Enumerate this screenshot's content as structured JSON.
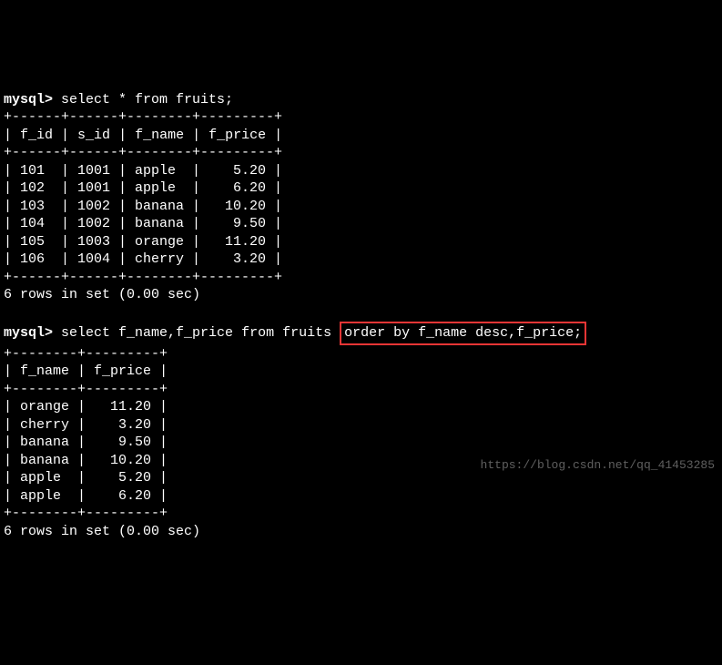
{
  "query1": {
    "prompt": "mysql>",
    "sql": "select * from fruits;",
    "headers": [
      "f_id",
      "s_id",
      "f_name",
      "f_price"
    ],
    "rows": [
      {
        "f_id": "101",
        "s_id": "1001",
        "f_name": "apple",
        "f_price": "5.20"
      },
      {
        "f_id": "102",
        "s_id": "1001",
        "f_name": "apple",
        "f_price": "6.20"
      },
      {
        "f_id": "103",
        "s_id": "1002",
        "f_name": "banana",
        "f_price": "10.20"
      },
      {
        "f_id": "104",
        "s_id": "1002",
        "f_name": "banana",
        "f_price": "9.50"
      },
      {
        "f_id": "105",
        "s_id": "1003",
        "f_name": "orange",
        "f_price": "11.20"
      },
      {
        "f_id": "106",
        "s_id": "1004",
        "f_name": "cherry",
        "f_price": "3.20"
      }
    ],
    "footer": "6 rows in set (0.00 sec)",
    "border": "+------+------+--------+---------+"
  },
  "query2": {
    "prompt": "mysql>",
    "sql_part1": "select f_name,f_price from fruits ",
    "sql_highlight": "order by f_name desc,f_price;",
    "headers": [
      "f_name",
      "f_price"
    ],
    "rows": [
      {
        "f_name": "orange",
        "f_price": "11.20"
      },
      {
        "f_name": "cherry",
        "f_price": "3.20"
      },
      {
        "f_name": "banana",
        "f_price": "9.50"
      },
      {
        "f_name": "banana",
        "f_price": "10.20"
      },
      {
        "f_name": "apple",
        "f_price": "5.20"
      },
      {
        "f_name": "apple",
        "f_price": "6.20"
      }
    ],
    "footer": "6 rows in set (0.00 sec)",
    "border": "+--------+---------+"
  },
  "watermark": "https://blog.csdn.net/qq_41453285",
  "chart_data": {
    "type": "table",
    "tables": [
      {
        "title": "fruits (full table)",
        "columns": [
          "f_id",
          "s_id",
          "f_name",
          "f_price"
        ],
        "rows": [
          [
            101,
            1001,
            "apple",
            5.2
          ],
          [
            102,
            1001,
            "apple",
            6.2
          ],
          [
            103,
            1002,
            "banana",
            10.2
          ],
          [
            104,
            1002,
            "banana",
            9.5
          ],
          [
            105,
            1003,
            "orange",
            11.2
          ],
          [
            106,
            1004,
            "cherry",
            3.2
          ]
        ]
      },
      {
        "title": "fruits ordered by f_name desc, f_price",
        "columns": [
          "f_name",
          "f_price"
        ],
        "rows": [
          [
            "orange",
            11.2
          ],
          [
            "cherry",
            3.2
          ],
          [
            "banana",
            9.5
          ],
          [
            "banana",
            10.2
          ],
          [
            "apple",
            5.2
          ],
          [
            "apple",
            6.2
          ]
        ]
      }
    ]
  }
}
